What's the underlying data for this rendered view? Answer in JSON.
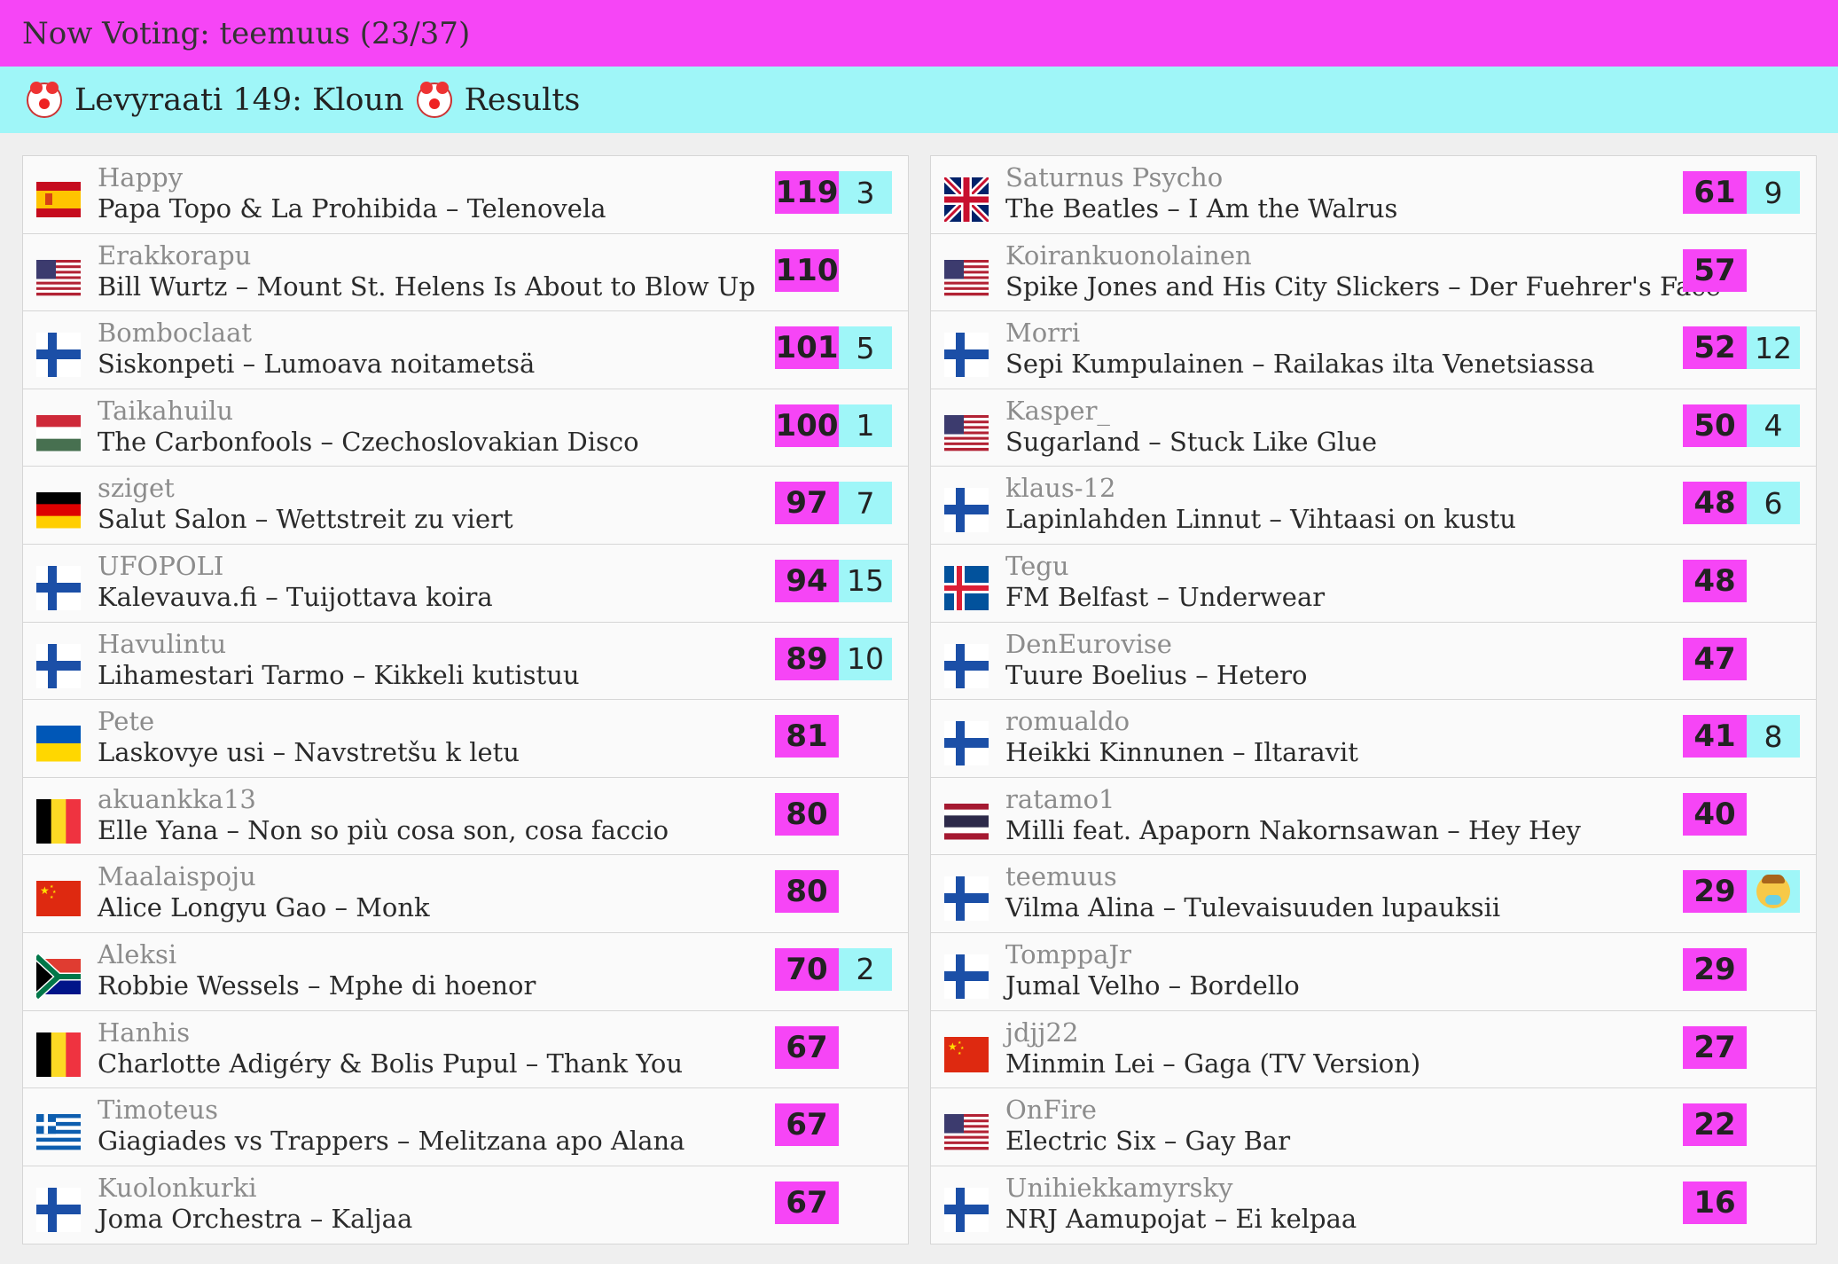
{
  "header": {
    "voting_label": "Now Voting: teemuus (23/37)",
    "title": "Levyraati 149: Kloun",
    "results_label": "Results",
    "title_icon": "clown-face-icon"
  },
  "colors": {
    "magenta": "#f645f6",
    "cyan": "#9ff6f8",
    "background": "#efefef"
  },
  "left_column": [
    {
      "flag": "spain",
      "voter": "Happy",
      "song": "Papa Topo & La Prohibida – Telenovela",
      "score": "119",
      "points": "3"
    },
    {
      "flag": "usa",
      "voter": "Erakkorapu",
      "song": "Bill Wurtz – Mount St. Helens Is About to Blow Up",
      "score": "110",
      "points": ""
    },
    {
      "flag": "finland",
      "voter": "Bomboclaat",
      "song": "Siskonpeti – Lumoava noitametsä",
      "score": "101",
      "points": "5"
    },
    {
      "flag": "hungary",
      "voter": "Taikahuilu",
      "song": "The Carbonfools – Czechoslovakian Disco",
      "score": "100",
      "points": "1"
    },
    {
      "flag": "germany",
      "voter": "sziget",
      "song": "Salut Salon – Wettstreit zu viert",
      "score": "97",
      "points": "7"
    },
    {
      "flag": "finland",
      "voter": "UFOPOLI",
      "song": "Kalevauva.fi – Tuijottava koira",
      "score": "94",
      "points": "15"
    },
    {
      "flag": "finland",
      "voter": "Havulintu",
      "song": "Lihamestari Tarmo – Kikkeli kutistuu",
      "score": "89",
      "points": "10"
    },
    {
      "flag": "ukraine",
      "voter": "Pete",
      "song": "Laskovye usi – Navstretšu k letu",
      "score": "81",
      "points": ""
    },
    {
      "flag": "belgium",
      "voter": "akuankka13",
      "song": "Elle Yana – Non so più cosa son, cosa faccio",
      "score": "80",
      "points": ""
    },
    {
      "flag": "china",
      "voter": "Maalaispoju",
      "song": "Alice Longyu Gao – Monk",
      "score": "80",
      "points": ""
    },
    {
      "flag": "south-africa",
      "voter": "Aleksi",
      "song": "Robbie Wessels – Mphe di hoenor",
      "score": "70",
      "points": "2"
    },
    {
      "flag": "belgium",
      "voter": "Hanhis",
      "song": "Charlotte Adigéry & Bolis Pupul – Thank You",
      "score": "67",
      "points": ""
    },
    {
      "flag": "greece",
      "voter": "Timoteus",
      "song": "Giagiades vs Trappers – Melitzana apo Alana",
      "score": "67",
      "points": ""
    },
    {
      "flag": "finland",
      "voter": "Kuolonkurki",
      "song": "Joma Orchestra – Kaljaa",
      "score": "67",
      "points": ""
    }
  ],
  "right_column": [
    {
      "flag": "uk",
      "voter": "Saturnus Psycho",
      "song": "The Beatles – I Am the Walrus",
      "score": "61",
      "points": "9"
    },
    {
      "flag": "usa",
      "voter": "Koirankuonolainen",
      "song": "Spike Jones and His City Slickers – Der Fuehrer's Face",
      "score": "57",
      "points": ""
    },
    {
      "flag": "finland",
      "voter": "Morri",
      "song": "Sepi Kumpulainen – Railakas ilta Venetsiassa",
      "score": "52",
      "points": "12"
    },
    {
      "flag": "usa",
      "voter": "Kasper_",
      "song": "Sugarland – Stuck Like Glue",
      "score": "50",
      "points": "4"
    },
    {
      "flag": "finland",
      "voter": "klaus-12",
      "song": "Lapinlahden Linnut – Vihtaasi on kustu",
      "score": "48",
      "points": "6"
    },
    {
      "flag": "iceland",
      "voter": "Tegu",
      "song": "FM Belfast – Underwear",
      "score": "48",
      "points": ""
    },
    {
      "flag": "finland",
      "voter": "DenEurovise",
      "song": "Tuure Boelius – Hetero",
      "score": "47",
      "points": ""
    },
    {
      "flag": "finland",
      "voter": "romualdo",
      "song": "Heikki Kinnunen – Iltaravit",
      "score": "41",
      "points": "8"
    },
    {
      "flag": "thailand",
      "voter": "ratamo1",
      "song": "Milli feat. Apaporn Nakornsawan – Hey Hey",
      "score": "40",
      "points": ""
    },
    {
      "flag": "finland",
      "voter": "teemuus",
      "song": "Vilma Alina – Tulevaisuuden lupauksii",
      "score": "29",
      "points": "",
      "icon": "baby-icon"
    },
    {
      "flag": "finland",
      "voter": "TomppaJr",
      "song": "Jumal Velho – Bordello",
      "score": "29",
      "points": ""
    },
    {
      "flag": "china",
      "voter": "jdjj22",
      "song": "Minmin Lei – Gaga (TV Version)",
      "score": "27",
      "points": ""
    },
    {
      "flag": "usa",
      "voter": "OnFire",
      "song": "Electric Six – Gay Bar",
      "score": "22",
      "points": ""
    },
    {
      "flag": "finland",
      "voter": "Unihiekkamyrsky",
      "song": "NRJ Aamupojat – Ei kelpaa",
      "score": "16",
      "points": ""
    }
  ]
}
